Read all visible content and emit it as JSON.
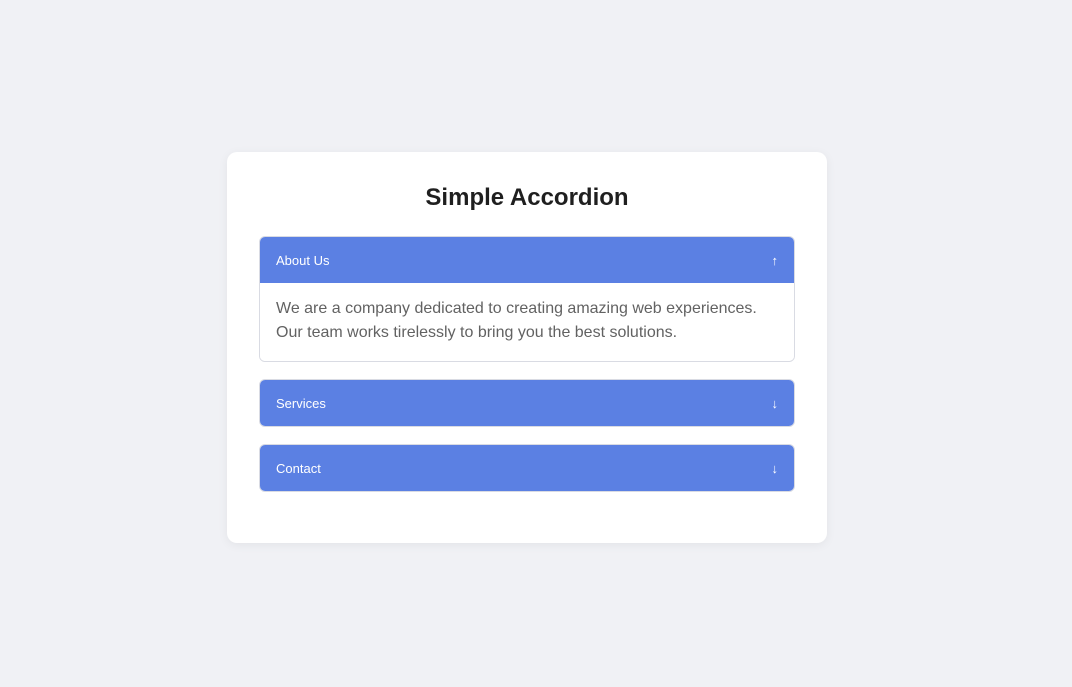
{
  "page": {
    "title": "Simple Accordion"
  },
  "accordion": {
    "items": [
      {
        "label": "About Us",
        "icon": "↑",
        "expanded": true,
        "content": "We are a company dedicated to creating amazing web experiences. Our team works tirelessly to bring you the best solutions."
      },
      {
        "label": "Services",
        "icon": "↓",
        "expanded": false
      },
      {
        "label": "Contact",
        "icon": "↓",
        "expanded": false
      }
    ]
  },
  "colors": {
    "header_bg": "#5b80e3",
    "header_text": "#ffffff",
    "page_bg": "#f0f1f5"
  }
}
